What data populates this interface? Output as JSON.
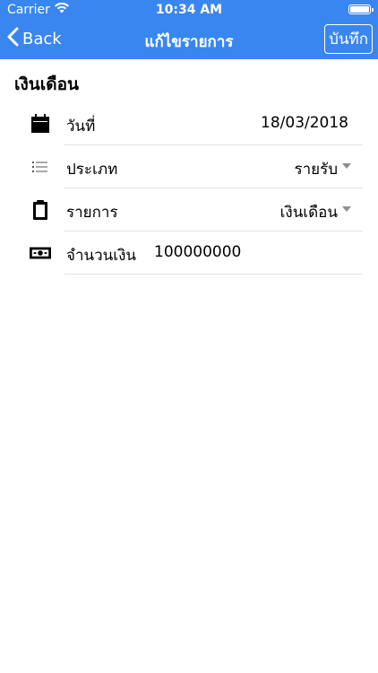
{
  "status_bar": {
    "carrier": "Carrier",
    "time": "10:34 AM",
    "wifi_icon": "wifi-icon",
    "battery_icon": "battery-icon"
  },
  "nav": {
    "back_label": "Back",
    "title": "แก้ไขรายการ",
    "save_label": "บันทึก",
    "accent_color": "#3a86f0"
  },
  "section": {
    "title": "เงินเดือน"
  },
  "rows": {
    "date": {
      "label": "วันที่",
      "value": "18/03/2018",
      "icon": "calendar-icon"
    },
    "type": {
      "label": "ประเภท",
      "value": "รายรับ",
      "icon": "list-icon"
    },
    "item": {
      "label": "รายการ",
      "value": "เงินเดือน",
      "icon": "clipboard-icon"
    },
    "amount": {
      "label": "จำนวนเงิน",
      "value": "100000000",
      "icon": "money-icon"
    }
  }
}
